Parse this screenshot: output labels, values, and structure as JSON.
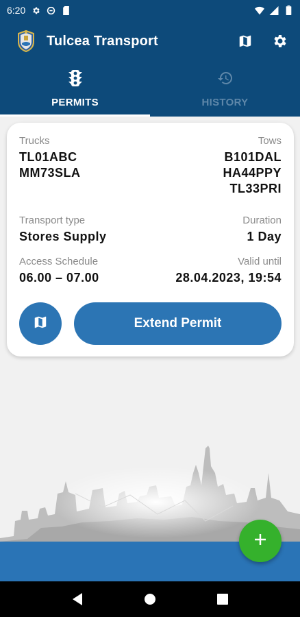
{
  "status_bar": {
    "time": "6:20"
  },
  "app_bar": {
    "title": "Tulcea Transport"
  },
  "tabs": [
    {
      "label": "PERMITS",
      "active": true,
      "icon": "traffic-light-icon"
    },
    {
      "label": "HISTORY",
      "active": false,
      "icon": "history-icon"
    }
  ],
  "permit": {
    "trucks_label": "Trucks",
    "trucks": [
      "TL01ABC",
      "MM73SLA"
    ],
    "tows_label": "Tows",
    "tows": [
      "B101DAL",
      "HA44PPY",
      "TL33PRI"
    ],
    "transport_type_label": "Transport type",
    "transport_type": "Stores Supply",
    "duration_label": "Duration",
    "duration": "1 Day",
    "access_schedule_label": "Access Schedule",
    "access_schedule": "06.00 – 07.00",
    "valid_until_label": "Valid until",
    "valid_until": "28.04.2023, 19:54",
    "extend_label": "Extend Permit"
  },
  "colors": {
    "primary": "#0d4a7a",
    "accent": "#2c75b4",
    "fab": "#35b12c"
  }
}
